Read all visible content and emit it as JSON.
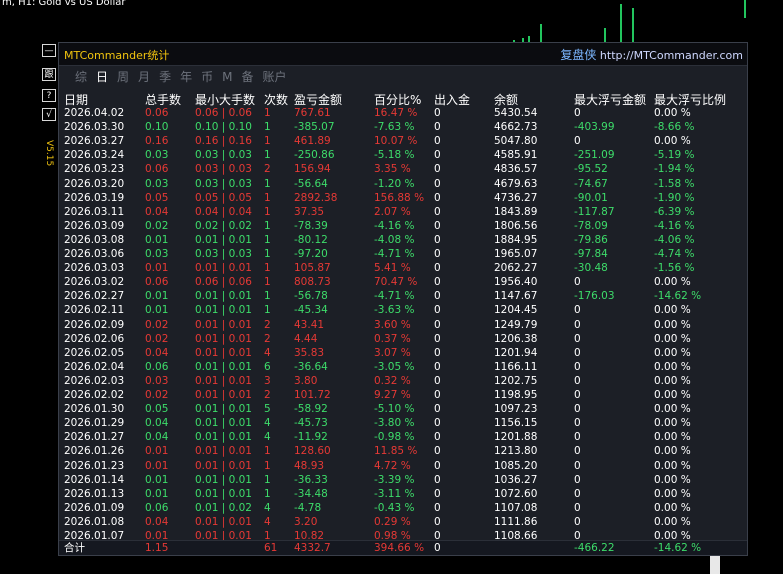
{
  "chart": {
    "title": "m, H1:  Gold vs US Dollar"
  },
  "side_buttons": [
    "—",
    "跟",
    "?",
    "√"
  ],
  "version": "V5.15",
  "panel": {
    "brand": "MTCommander统计",
    "site_cn": "复盘侠",
    "site_url": "http://MTCommander.com",
    "tabs": [
      "综",
      "日",
      "周",
      "月",
      "季",
      "年",
      "币",
      "M",
      "备",
      "账户"
    ],
    "active_tab": 1,
    "headers": [
      "日期",
      "总手数",
      "最小大手数",
      "次数",
      "盈亏金额",
      "百分比%",
      "出入金",
      "余额",
      "最大浮亏金额",
      "最大浮亏比例"
    ],
    "rows": [
      {
        "date": "2026.04.02",
        "lots": "0.06",
        "minmax": "0.06 | 0.06",
        "count": "1",
        "pnl": "767.61",
        "pct": "16.47 %",
        "io": "0",
        "bal": "5430.54",
        "maxdd": "0",
        "maxddp": "0.00 %",
        "c": "red",
        "dc": "white"
      },
      {
        "date": "2026.03.30",
        "lots": "0.10",
        "minmax": "0.10 | 0.10",
        "count": "1",
        "pnl": "-385.07",
        "pct": "-7.63 %",
        "io": "0",
        "bal": "4662.73",
        "maxdd": "-403.99",
        "maxddp": "-8.66 %",
        "c": "green",
        "dc": "green"
      },
      {
        "date": "2026.03.27",
        "lots": "0.16",
        "minmax": "0.16 | 0.16",
        "count": "1",
        "pnl": "461.89",
        "pct": "10.07 %",
        "io": "0",
        "bal": "5047.80",
        "maxdd": "0",
        "maxddp": "0.00 %",
        "c": "red",
        "dc": "white"
      },
      {
        "date": "2026.03.24",
        "lots": "0.03",
        "minmax": "0.03 | 0.03",
        "count": "1",
        "pnl": "-250.86",
        "pct": "-5.18 %",
        "io": "0",
        "bal": "4585.91",
        "maxdd": "-251.09",
        "maxddp": "-5.19 %",
        "c": "green",
        "dc": "green"
      },
      {
        "date": "2026.03.23",
        "lots": "0.06",
        "minmax": "0.03 | 0.03",
        "count": "2",
        "pnl": "156.94",
        "pct": "3.35 %",
        "io": "0",
        "bal": "4836.57",
        "maxdd": "-95.52",
        "maxddp": "-1.94 %",
        "c": "red",
        "dc": "green"
      },
      {
        "date": "2026.03.20",
        "lots": "0.03",
        "minmax": "0.03 | 0.03",
        "count": "1",
        "pnl": "-56.64",
        "pct": "-1.20 %",
        "io": "0",
        "bal": "4679.63",
        "maxdd": "-74.67",
        "maxddp": "-1.58 %",
        "c": "green",
        "dc": "green"
      },
      {
        "date": "2026.03.19",
        "lots": "0.05",
        "minmax": "0.05 | 0.05",
        "count": "1",
        "pnl": "2892.38",
        "pct": "156.88 %",
        "io": "0",
        "bal": "4736.27",
        "maxdd": "-90.01",
        "maxddp": "-1.90 %",
        "c": "red",
        "dc": "green"
      },
      {
        "date": "2026.03.11",
        "lots": "0.04",
        "minmax": "0.04 | 0.04",
        "count": "1",
        "pnl": "37.35",
        "pct": "2.07 %",
        "io": "0",
        "bal": "1843.89",
        "maxdd": "-117.87",
        "maxddp": "-6.39 %",
        "c": "red",
        "dc": "green"
      },
      {
        "date": "2026.03.09",
        "lots": "0.02",
        "minmax": "0.02 | 0.02",
        "count": "1",
        "pnl": "-78.39",
        "pct": "-4.16 %",
        "io": "0",
        "bal": "1806.56",
        "maxdd": "-78.09",
        "maxddp": "-4.16 %",
        "c": "green",
        "dc": "green"
      },
      {
        "date": "2026.03.08",
        "lots": "0.01",
        "minmax": "0.01 | 0.01",
        "count": "1",
        "pnl": "-80.12",
        "pct": "-4.08 %",
        "io": "0",
        "bal": "1884.95",
        "maxdd": "-79.86",
        "maxddp": "-4.06 %",
        "c": "green",
        "dc": "green"
      },
      {
        "date": "2026.03.06",
        "lots": "0.03",
        "minmax": "0.03 | 0.03",
        "count": "1",
        "pnl": "-97.20",
        "pct": "-4.71 %",
        "io": "0",
        "bal": "1965.07",
        "maxdd": "-97.84",
        "maxddp": "-4.74 %",
        "c": "green",
        "dc": "green"
      },
      {
        "date": "2026.03.03",
        "lots": "0.01",
        "minmax": "0.01 | 0.01",
        "count": "1",
        "pnl": "105.87",
        "pct": "5.41 %",
        "io": "0",
        "bal": "2062.27",
        "maxdd": "-30.48",
        "maxddp": "-1.56 %",
        "c": "red",
        "dc": "green"
      },
      {
        "date": "2026.03.02",
        "lots": "0.06",
        "minmax": "0.06 | 0.06",
        "count": "1",
        "pnl": "808.73",
        "pct": "70.47 %",
        "io": "0",
        "bal": "1956.40",
        "maxdd": "0",
        "maxddp": "0.00 %",
        "c": "red",
        "dc": "white"
      },
      {
        "date": "2026.02.27",
        "lots": "0.01",
        "minmax": "0.01 | 0.01",
        "count": "1",
        "pnl": "-56.78",
        "pct": "-4.71 %",
        "io": "0",
        "bal": "1147.67",
        "maxdd": "-176.03",
        "maxddp": "-14.62 %",
        "c": "green",
        "dc": "green"
      },
      {
        "date": "2026.02.11",
        "lots": "0.01",
        "minmax": "0.01 | 0.01",
        "count": "1",
        "pnl": "-45.34",
        "pct": "-3.63 %",
        "io": "0",
        "bal": "1204.45",
        "maxdd": "0",
        "maxddp": "0.00 %",
        "c": "green",
        "dc": "white"
      },
      {
        "date": "2026.02.09",
        "lots": "0.02",
        "minmax": "0.01 | 0.01",
        "count": "2",
        "pnl": "43.41",
        "pct": "3.60 %",
        "io": "0",
        "bal": "1249.79",
        "maxdd": "0",
        "maxddp": "0.00 %",
        "c": "red",
        "dc": "white"
      },
      {
        "date": "2026.02.06",
        "lots": "0.02",
        "minmax": "0.01 | 0.01",
        "count": "2",
        "pnl": "4.44",
        "pct": "0.37 %",
        "io": "0",
        "bal": "1206.38",
        "maxdd": "0",
        "maxddp": "0.00 %",
        "c": "red",
        "dc": "white"
      },
      {
        "date": "2026.02.05",
        "lots": "0.04",
        "minmax": "0.01 | 0.01",
        "count": "4",
        "pnl": "35.83",
        "pct": "3.07 %",
        "io": "0",
        "bal": "1201.94",
        "maxdd": "0",
        "maxddp": "0.00 %",
        "c": "red",
        "dc": "white"
      },
      {
        "date": "2026.02.04",
        "lots": "0.06",
        "minmax": "0.01 | 0.01",
        "count": "6",
        "pnl": "-36.64",
        "pct": "-3.05 %",
        "io": "0",
        "bal": "1166.11",
        "maxdd": "0",
        "maxddp": "0.00 %",
        "c": "green",
        "dc": "white"
      },
      {
        "date": "2026.02.03",
        "lots": "0.03",
        "minmax": "0.01 | 0.01",
        "count": "3",
        "pnl": "3.80",
        "pct": "0.32 %",
        "io": "0",
        "bal": "1202.75",
        "maxdd": "0",
        "maxddp": "0.00 %",
        "c": "red",
        "dc": "white"
      },
      {
        "date": "2026.02.02",
        "lots": "0.02",
        "minmax": "0.01 | 0.01",
        "count": "2",
        "pnl": "101.72",
        "pct": "9.27 %",
        "io": "0",
        "bal": "1198.95",
        "maxdd": "0",
        "maxddp": "0.00 %",
        "c": "red",
        "dc": "white"
      },
      {
        "date": "2026.01.30",
        "lots": "0.05",
        "minmax": "0.01 | 0.01",
        "count": "5",
        "pnl": "-58.92",
        "pct": "-5.10 %",
        "io": "0",
        "bal": "1097.23",
        "maxdd": "0",
        "maxddp": "0.00 %",
        "c": "green",
        "dc": "white"
      },
      {
        "date": "2026.01.29",
        "lots": "0.04",
        "minmax": "0.01 | 0.01",
        "count": "4",
        "pnl": "-45.73",
        "pct": "-3.80 %",
        "io": "0",
        "bal": "1156.15",
        "maxdd": "0",
        "maxddp": "0.00 %",
        "c": "green",
        "dc": "white"
      },
      {
        "date": "2026.01.27",
        "lots": "0.04",
        "minmax": "0.01 | 0.01",
        "count": "4",
        "pnl": "-11.92",
        "pct": "-0.98 %",
        "io": "0",
        "bal": "1201.88",
        "maxdd": "0",
        "maxddp": "0.00 %",
        "c": "green",
        "dc": "white"
      },
      {
        "date": "2026.01.26",
        "lots": "0.01",
        "minmax": "0.01 | 0.01",
        "count": "1",
        "pnl": "128.60",
        "pct": "11.85 %",
        "io": "0",
        "bal": "1213.80",
        "maxdd": "0",
        "maxddp": "0.00 %",
        "c": "red",
        "dc": "white"
      },
      {
        "date": "2026.01.23",
        "lots": "0.01",
        "minmax": "0.01 | 0.01",
        "count": "1",
        "pnl": "48.93",
        "pct": "4.72 %",
        "io": "0",
        "bal": "1085.20",
        "maxdd": "0",
        "maxddp": "0.00 %",
        "c": "red",
        "dc": "white"
      },
      {
        "date": "2026.01.14",
        "lots": "0.01",
        "minmax": "0.01 | 0.01",
        "count": "1",
        "pnl": "-36.33",
        "pct": "-3.39 %",
        "io": "0",
        "bal": "1036.27",
        "maxdd": "0",
        "maxddp": "0.00 %",
        "c": "green",
        "dc": "white"
      },
      {
        "date": "2026.01.13",
        "lots": "0.01",
        "minmax": "0.01 | 0.01",
        "count": "1",
        "pnl": "-34.48",
        "pct": "-3.11 %",
        "io": "0",
        "bal": "1072.60",
        "maxdd": "0",
        "maxddp": "0.00 %",
        "c": "green",
        "dc": "white"
      },
      {
        "date": "2026.01.09",
        "lots": "0.06",
        "minmax": "0.01 | 0.02",
        "count": "4",
        "pnl": "-4.78",
        "pct": "-0.43 %",
        "io": "0",
        "bal": "1107.08",
        "maxdd": "0",
        "maxddp": "0.00 %",
        "c": "green",
        "dc": "white"
      },
      {
        "date": "2026.01.08",
        "lots": "0.04",
        "minmax": "0.01 | 0.01",
        "count": "4",
        "pnl": "3.20",
        "pct": "0.29 %",
        "io": "0",
        "bal": "1111.86",
        "maxdd": "0",
        "maxddp": "0.00 %",
        "c": "red",
        "dc": "white"
      },
      {
        "date": "2026.01.07",
        "lots": "0.01",
        "minmax": "0.01 | 0.01",
        "count": "1",
        "pnl": "10.82",
        "pct": "0.98 %",
        "io": "0",
        "bal": "1108.66",
        "maxdd": "0",
        "maxddp": "0.00 %",
        "c": "red",
        "dc": "white"
      }
    ],
    "total": {
      "label": "合计",
      "lots": "1.15",
      "count": "61",
      "pnl": "4332.7",
      "pct": "394.66 %",
      "io": "0",
      "maxdd": "-466.22",
      "maxddp": "-14.62 %"
    }
  },
  "colors": {
    "profit": "#e53935",
    "loss": "#3ddc6a",
    "brand": "#f1c40f"
  }
}
